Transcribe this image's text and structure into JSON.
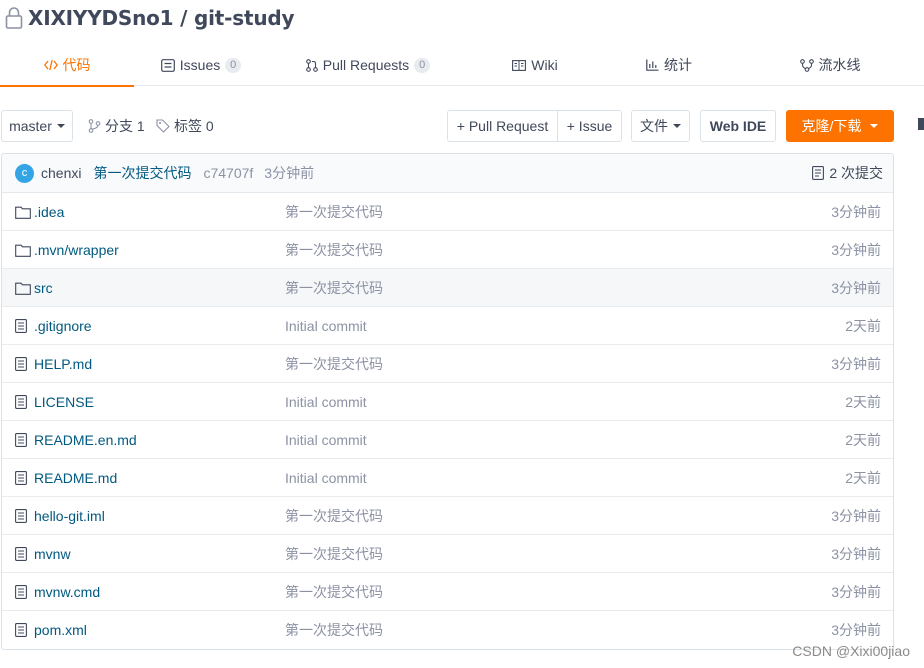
{
  "repo": {
    "title": "XIXIYYDSno1 / git-study"
  },
  "tabs": [
    {
      "label": "代码",
      "icon": "code-icon",
      "active": true
    },
    {
      "label": "Issues",
      "icon": "issues-icon",
      "count": "0"
    },
    {
      "label": "Pull Requests",
      "icon": "pull-request-icon",
      "count": "0"
    },
    {
      "label": "Wiki",
      "icon": "wiki-icon"
    },
    {
      "label": "统计",
      "icon": "stats-icon"
    },
    {
      "label": "流水线",
      "icon": "pipeline-icon"
    }
  ],
  "toolbar": {
    "branch": "master",
    "branches": "分支 1",
    "tags": "标签 0",
    "pull_request": "+ Pull Request",
    "issue": "+ Issue",
    "files": "文件",
    "web_ide": "Web IDE",
    "clone": "克隆/下载"
  },
  "commit": {
    "avatar": "c",
    "author": "chenxi",
    "message": "第一次提交代码",
    "hash": "c74707f",
    "time": "3分钟前",
    "count": "2 次提交"
  },
  "files": [
    {
      "name": ".idea",
      "type": "folder",
      "message": "第一次提交代码",
      "time": "3分钟前"
    },
    {
      "name": ".mvn/wrapper",
      "type": "folder",
      "message": "第一次提交代码",
      "time": "3分钟前"
    },
    {
      "name": "src",
      "type": "folder",
      "message": "第一次提交代码",
      "time": "3分钟前"
    },
    {
      "name": ".gitignore",
      "type": "file",
      "message": "Initial commit",
      "time": "2天前"
    },
    {
      "name": "HELP.md",
      "type": "file",
      "message": "第一次提交代码",
      "time": "3分钟前"
    },
    {
      "name": "LICENSE",
      "type": "file",
      "message": "Initial commit",
      "time": "2天前"
    },
    {
      "name": "README.en.md",
      "type": "file",
      "message": "Initial commit",
      "time": "2天前"
    },
    {
      "name": "README.md",
      "type": "file",
      "message": "Initial commit",
      "time": "2天前"
    },
    {
      "name": "hello-git.iml",
      "type": "file",
      "message": "第一次提交代码",
      "time": "3分钟前"
    },
    {
      "name": "mvnw",
      "type": "file",
      "message": "第一次提交代码",
      "time": "3分钟前"
    },
    {
      "name": "mvnw.cmd",
      "type": "file",
      "message": "第一次提交代码",
      "time": "3分钟前"
    },
    {
      "name": "pom.xml",
      "type": "file",
      "message": "第一次提交代码",
      "time": "3分钟前"
    }
  ],
  "watermark": "CSDN @Xixi00jiao",
  "colors": {
    "accent": "#fe7300",
    "link": "#005980",
    "muted": "#8c92a4",
    "text": "#40485b"
  }
}
